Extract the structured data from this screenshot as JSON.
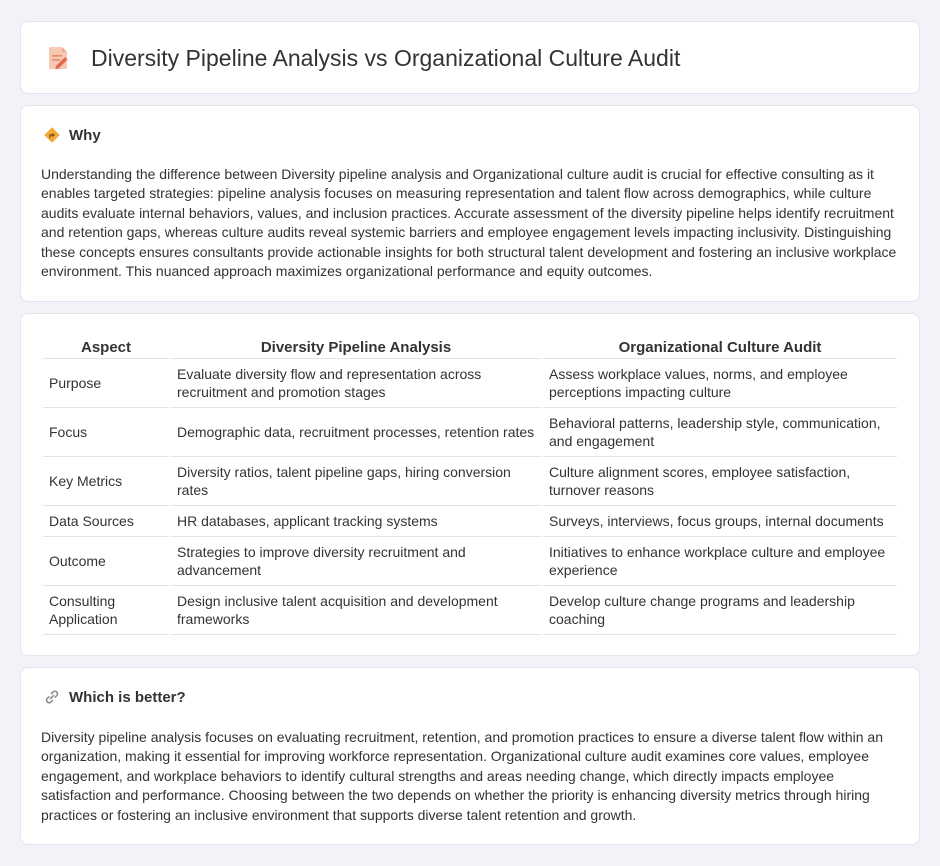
{
  "header": {
    "title": "Diversity Pipeline Analysis vs Organizational Culture Audit",
    "icon": "document-edit-icon"
  },
  "why": {
    "icon": "road-sign-icon",
    "title": "Why",
    "body": "Understanding the difference between Diversity pipeline analysis and Organizational culture audit is crucial for effective consulting as it enables targeted strategies: pipeline analysis focuses on measuring representation and talent flow across demographics, while culture audits evaluate internal behaviors, values, and inclusion practices. Accurate assessment of the diversity pipeline helps identify recruitment and retention gaps, whereas culture audits reveal systemic barriers and employee engagement levels impacting inclusivity. Distinguishing these concepts ensures consultants provide actionable insights for both structural talent development and fostering an inclusive workplace environment. This nuanced approach maximizes organizational performance and equity outcomes."
  },
  "comparison": {
    "headers": [
      "Aspect",
      "Diversity Pipeline Analysis",
      "Organizational Culture Audit"
    ],
    "rows": [
      [
        "Purpose",
        "Evaluate diversity flow and representation across recruitment and promotion stages",
        "Assess workplace values, norms, and employee perceptions impacting culture"
      ],
      [
        "Focus",
        "Demographic data, recruitment processes, retention rates",
        "Behavioral patterns, leadership style, communication, and engagement"
      ],
      [
        "Key Metrics",
        "Diversity ratios, talent pipeline gaps, hiring conversion rates",
        "Culture alignment scores, employee satisfaction, turnover reasons"
      ],
      [
        "Data Sources",
        "HR databases, applicant tracking systems",
        "Surveys, interviews, focus groups, internal documents"
      ],
      [
        "Outcome",
        "Strategies to improve diversity recruitment and advancement",
        "Initiatives to enhance workplace culture and employee experience"
      ],
      [
        "Consulting Application",
        "Design inclusive talent acquisition and development frameworks",
        "Develop culture change programs and leadership coaching"
      ]
    ]
  },
  "better": {
    "icon": "link-icon",
    "title": "Which is better?",
    "body": "Diversity pipeline analysis focuses on evaluating recruitment, retention, and promotion practices to ensure a diverse talent flow within an organization, making it essential for improving workforce representation. Organizational culture audit examines core values, employee engagement, and workplace behaviors to identify cultural strengths and areas needing change, which directly impacts employee satisfaction and performance. Choosing between the two depends on whether the priority is enhancing diversity metrics through hiring practices or fostering an inclusive environment that supports diverse talent retention and growth."
  }
}
